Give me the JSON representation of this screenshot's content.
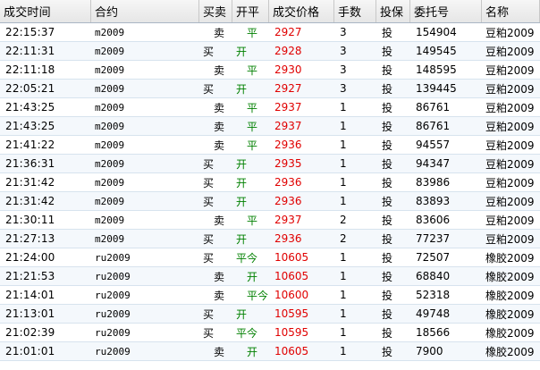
{
  "headers": {
    "time": "成交时间",
    "contract": "合约",
    "bs": "买卖",
    "oc": "开平",
    "price": "成交价格",
    "qty": "手数",
    "hedge": "投保",
    "orderid": "委托号",
    "name": "名称"
  },
  "rows": [
    {
      "time": "22:15:37",
      "contract": "m2009",
      "bs": "卖",
      "oc": "平",
      "price": "2927",
      "qty": "3",
      "hedge": "投",
      "orderid": "154904",
      "name": "豆粕2009"
    },
    {
      "time": "22:11:31",
      "contract": "m2009",
      "bs": "买",
      "oc": "开",
      "price": "2928",
      "qty": "3",
      "hedge": "投",
      "orderid": "149545",
      "name": "豆粕2009"
    },
    {
      "time": "22:11:18",
      "contract": "m2009",
      "bs": "卖",
      "oc": "平",
      "price": "2930",
      "qty": "3",
      "hedge": "投",
      "orderid": "148595",
      "name": "豆粕2009"
    },
    {
      "time": "22:05:21",
      "contract": "m2009",
      "bs": "买",
      "oc": "开",
      "price": "2927",
      "qty": "3",
      "hedge": "投",
      "orderid": "139445",
      "name": "豆粕2009"
    },
    {
      "time": "21:43:25",
      "contract": "m2009",
      "bs": "卖",
      "oc": "平",
      "price": "2937",
      "qty": "1",
      "hedge": "投",
      "orderid": "86761",
      "name": "豆粕2009"
    },
    {
      "time": "21:43:25",
      "contract": "m2009",
      "bs": "卖",
      "oc": "平",
      "price": "2937",
      "qty": "1",
      "hedge": "投",
      "orderid": "86761",
      "name": "豆粕2009"
    },
    {
      "time": "21:41:22",
      "contract": "m2009",
      "bs": "卖",
      "oc": "平",
      "price": "2936",
      "qty": "1",
      "hedge": "投",
      "orderid": "94557",
      "name": "豆粕2009"
    },
    {
      "time": "21:36:31",
      "contract": "m2009",
      "bs": "买",
      "oc": "开",
      "price": "2935",
      "qty": "1",
      "hedge": "投",
      "orderid": "94347",
      "name": "豆粕2009"
    },
    {
      "time": "21:31:42",
      "contract": "m2009",
      "bs": "买",
      "oc": "开",
      "price": "2936",
      "qty": "1",
      "hedge": "投",
      "orderid": "83986",
      "name": "豆粕2009"
    },
    {
      "time": "21:31:42",
      "contract": "m2009",
      "bs": "买",
      "oc": "开",
      "price": "2936",
      "qty": "1",
      "hedge": "投",
      "orderid": "83893",
      "name": "豆粕2009"
    },
    {
      "time": "21:30:11",
      "contract": "m2009",
      "bs": "卖",
      "oc": "平",
      "price": "2937",
      "qty": "2",
      "hedge": "投",
      "orderid": "83606",
      "name": "豆粕2009"
    },
    {
      "time": "21:27:13",
      "contract": "m2009",
      "bs": "买",
      "oc": "开",
      "price": "2936",
      "qty": "2",
      "hedge": "投",
      "orderid": "77237",
      "name": "豆粕2009"
    },
    {
      "time": "21:24:00",
      "contract": "ru2009",
      "bs": "买",
      "oc": "平今",
      "price": "10605",
      "qty": "1",
      "hedge": "投",
      "orderid": "72507",
      "name": "橡胶2009"
    },
    {
      "time": "21:21:53",
      "contract": "ru2009",
      "bs": "卖",
      "oc": "开",
      "price": "10605",
      "qty": "1",
      "hedge": "投",
      "orderid": "68840",
      "name": "橡胶2009"
    },
    {
      "time": "21:14:01",
      "contract": "ru2009",
      "bs": "卖",
      "oc": "平今",
      "price": "10600",
      "qty": "1",
      "hedge": "投",
      "orderid": "52318",
      "name": "橡胶2009"
    },
    {
      "time": "21:13:01",
      "contract": "ru2009",
      "bs": "买",
      "oc": "开",
      "price": "10595",
      "qty": "1",
      "hedge": "投",
      "orderid": "49748",
      "name": "橡胶2009"
    },
    {
      "time": "21:02:39",
      "contract": "ru2009",
      "bs": "买",
      "oc": "平今",
      "price": "10595",
      "qty": "1",
      "hedge": "投",
      "orderid": "18566",
      "name": "橡胶2009"
    },
    {
      "time": "21:01:01",
      "contract": "ru2009",
      "bs": "卖",
      "oc": "开",
      "price": "10605",
      "qty": "1",
      "hedge": "投",
      "orderid": "7900",
      "name": "橡胶2009"
    }
  ],
  "colors": {
    "price": "#e00000",
    "open_close": "#008000",
    "row_alt": "#f4f8fc"
  }
}
